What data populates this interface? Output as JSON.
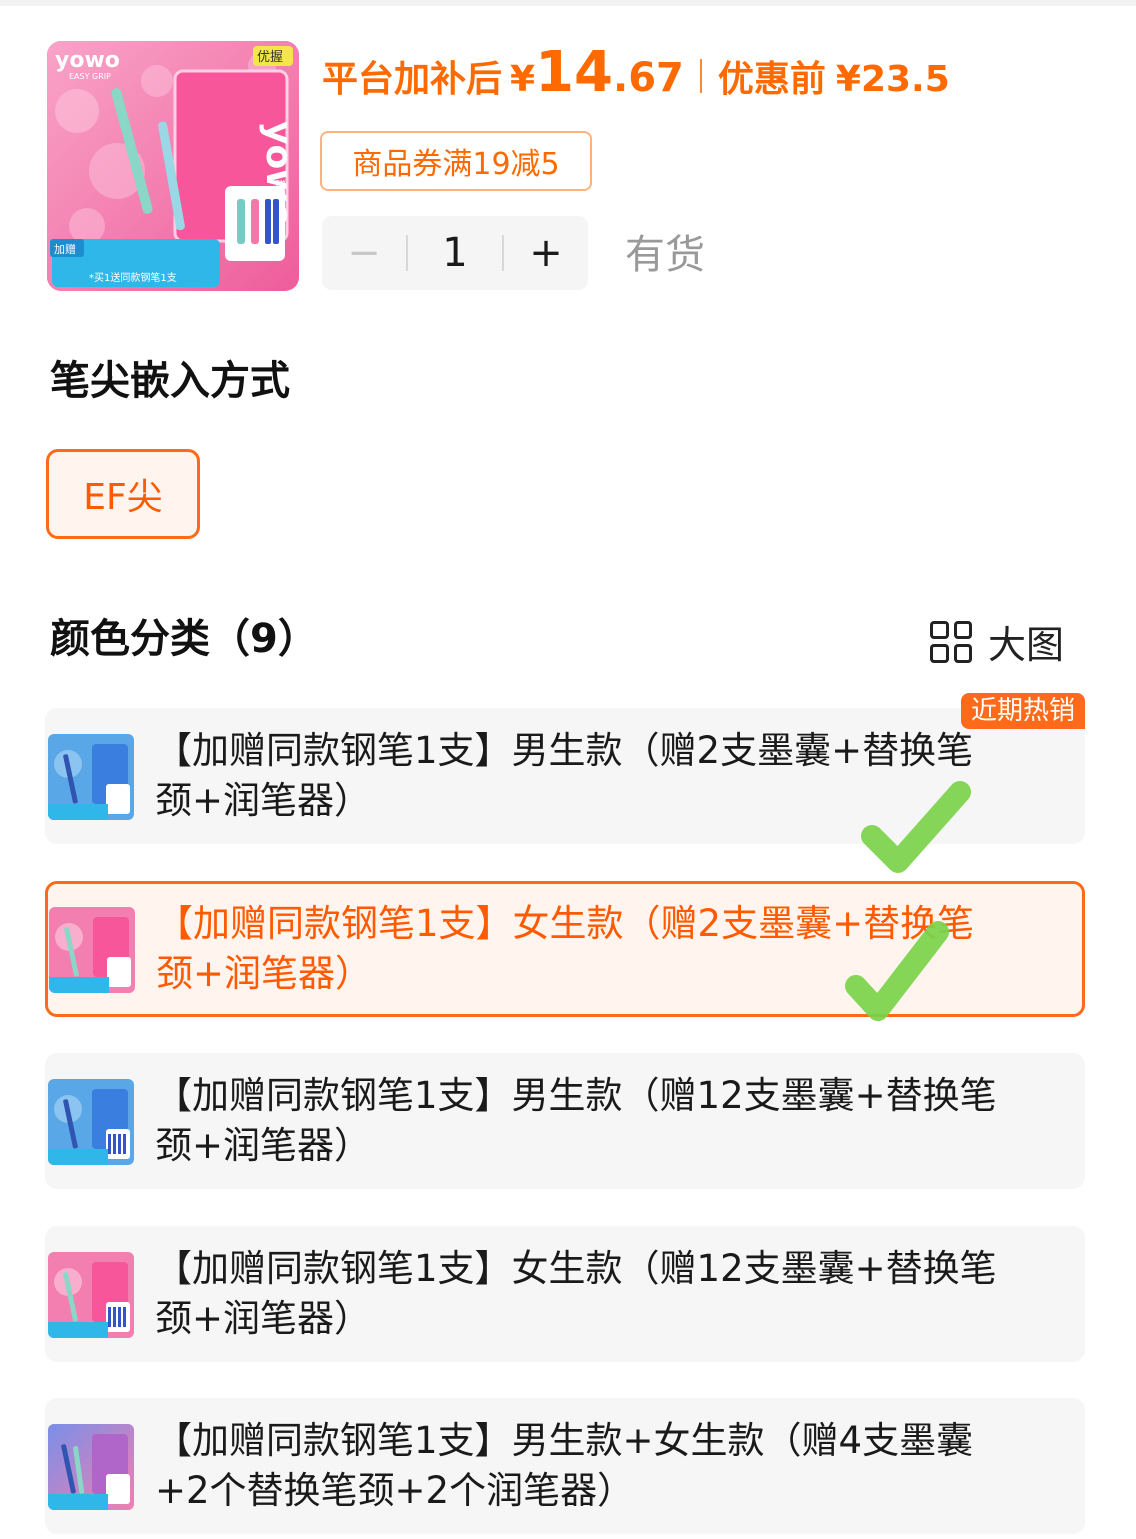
{
  "header": {
    "price_label": "平台加补后",
    "currency": "¥",
    "price_int": "14",
    "price_dec": ".67",
    "before_label": "优惠前",
    "before_price": "¥23.5",
    "coupon": "商品券满19减5"
  },
  "quantity": {
    "minus": "−",
    "value": "1",
    "plus": "+",
    "stock": "有货"
  },
  "product_image": {
    "brand": "yowo",
    "sub_brand": "EASY GRIP",
    "tag": "优握",
    "gift_badge": "赠",
    "bonus_badge": "加赠",
    "banner": "*买1送同款钢笔1支"
  },
  "nib": {
    "title": "笔尖嵌入方式",
    "options": [
      "EF尖"
    ],
    "selected": 0
  },
  "color": {
    "title": "颜色分类（9）",
    "big_view_label": "大图",
    "hot_badge": "近期热销",
    "options": [
      {
        "line1": "【加赠同款钢笔1支】男生款（赠2支墨囊+替换笔",
        "line2": "颈+润笔器）",
        "theme": "blue"
      },
      {
        "line1": "【加赠同款钢笔1支】女生款（赠2支墨囊+替换笔",
        "line2": "颈+润笔器）",
        "theme": "pink"
      },
      {
        "line1": "【加赠同款钢笔1支】男生款（赠12支墨囊+替换笔",
        "line2": "颈+润笔器）",
        "theme": "blue"
      },
      {
        "line1": "【加赠同款钢笔1支】女生款（赠12支墨囊+替换笔",
        "line2": "颈+润笔器）",
        "theme": "pink"
      },
      {
        "line1": "【加赠同款钢笔1支】男生款+女生款（赠4支墨囊",
        "line2": "+2个替换笔颈+2个润笔器）",
        "theme": "mixed"
      }
    ],
    "selected_index": 1
  },
  "colors": {
    "accent": "#ff6a00",
    "selected_border": "#ff6a1a",
    "selected_bg": "#fff4ee",
    "check": "#7bd34a"
  }
}
